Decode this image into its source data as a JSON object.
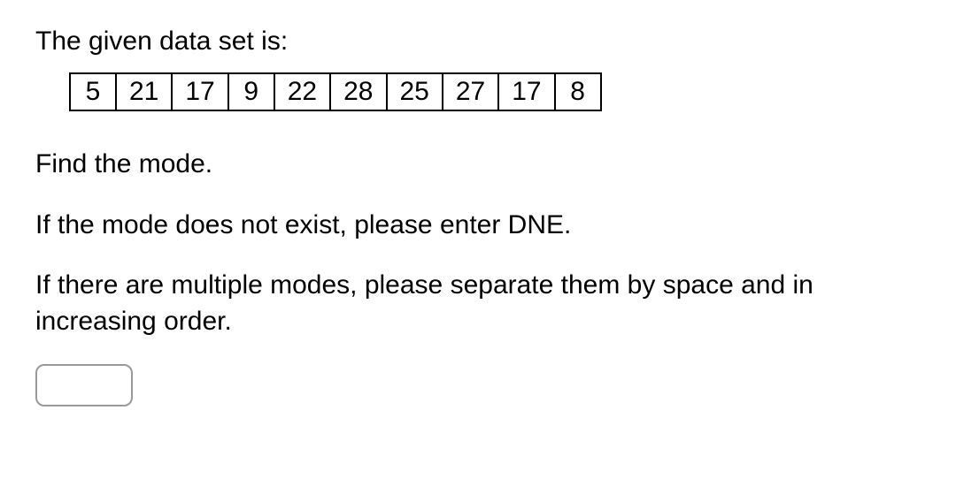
{
  "intro": "The given data set is:",
  "data_values": [
    "5",
    "21",
    "17",
    "9",
    "22",
    "28",
    "25",
    "27",
    "17",
    "8"
  ],
  "prompt_find": "Find the mode.",
  "prompt_dne": "If the mode does not exist, please enter DNE.",
  "prompt_multi": "If there are multiple modes, please separate them by space and in increasing order.",
  "answer_value": ""
}
